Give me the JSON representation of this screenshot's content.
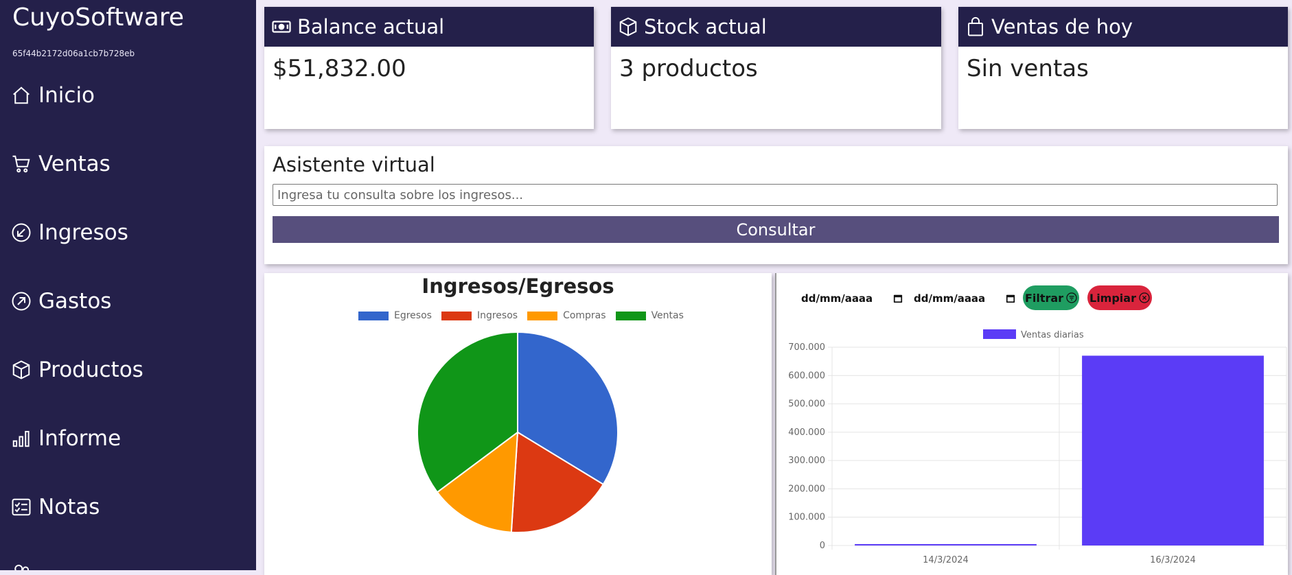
{
  "sidebar": {
    "brand": "CuyoSoftware",
    "user_id": "65f44b2172d06a1cb7b728eb",
    "items": [
      {
        "label": "Inicio",
        "icon": "home-icon"
      },
      {
        "label": "Ventas",
        "icon": "cart-icon"
      },
      {
        "label": "Ingresos",
        "icon": "arrow-down-left-circle-icon"
      },
      {
        "label": "Gastos",
        "icon": "arrow-up-right-circle-icon"
      },
      {
        "label": "Productos",
        "icon": "box-icon"
      },
      {
        "label": "Informe",
        "icon": "bar-chart-icon"
      },
      {
        "label": "Notas",
        "icon": "checklist-icon"
      }
    ]
  },
  "cards": {
    "balance": {
      "title": "Balance actual",
      "value": "$51,832.00",
      "icon": "cash-icon"
    },
    "stock": {
      "title": "Stock actual",
      "value": "3 productos",
      "icon": "box-icon"
    },
    "sales_today": {
      "title": "Ventas de hoy",
      "value": "Sin ventas",
      "icon": "bag-icon"
    }
  },
  "assistant": {
    "title": "Asistente virtual",
    "placeholder": "Ingresa tu consulta sobre los ingresos...",
    "button": "Consultar"
  },
  "filters": {
    "date_from": "dd/mm/aaaa",
    "date_to": "dd/mm/aaaa",
    "filter_button": "Filtrar",
    "clear_button": "Limpiar"
  },
  "colors": {
    "sidebar": "#24204a",
    "button": "#574f7d",
    "filter": "#1f9d61",
    "clear": "#d9243c",
    "bar": "#5b3cf6"
  },
  "chart_data": [
    {
      "type": "pie",
      "title": "Ingresos/Egresos",
      "legend_position": "top",
      "labels": [
        "Egresos",
        "Ingresos",
        "Compras",
        "Ventas"
      ],
      "colors": [
        "#3366cc",
        "#dc3912",
        "#ff9900",
        "#109618"
      ],
      "values": [
        33.7,
        17.3,
        13.8,
        35.2
      ]
    },
    {
      "type": "bar",
      "categories": [
        "14/3/2024",
        "16/3/2024"
      ],
      "series": [
        {
          "name": "Ventas diarias",
          "values": [
            5000,
            670000
          ]
        }
      ],
      "ylim": [
        0,
        700000
      ],
      "yticks": [
        "0",
        "100.000",
        "200.000",
        "300.000",
        "400.000",
        "500.000",
        "600.000",
        "700.000"
      ],
      "legend_position": "top",
      "grid": true
    }
  ]
}
